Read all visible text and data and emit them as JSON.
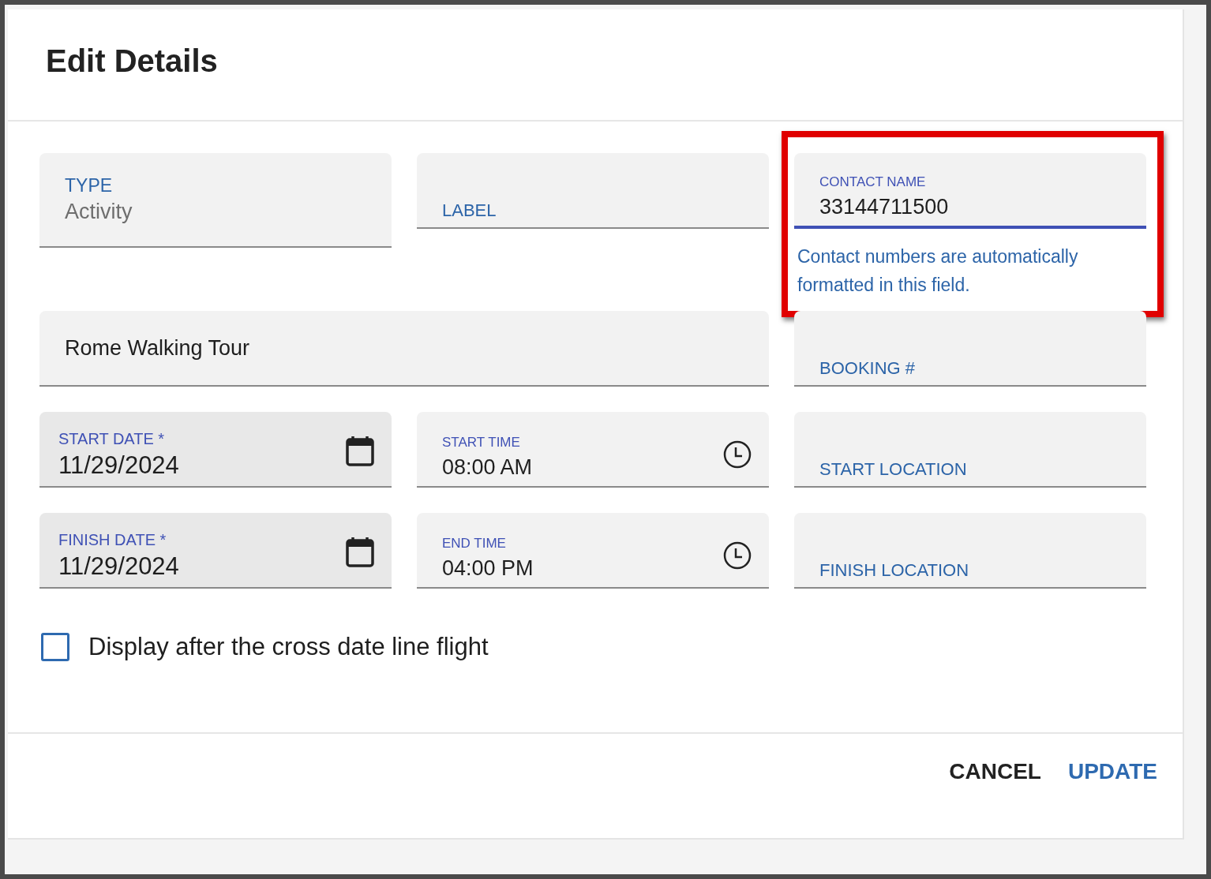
{
  "dialog": {
    "title": "Edit Details"
  },
  "fields": [
    {
      "kind": "select",
      "label": "TYPE",
      "value": "Activity"
    },
    {
      "kind": "text",
      "label": "LABEL"
    },
    {
      "kind": "text",
      "label": "CONTACT NAME",
      "value": "33144711500",
      "focused": true,
      "highlighted": true,
      "helper": "Contact numbers are automatically formatted in this field."
    },
    {
      "kind": "text",
      "wide": true,
      "value": "Rome Walking Tour"
    },
    {
      "kind": "text",
      "label": "BOOKING #"
    },
    {
      "kind": "date",
      "label": "START DATE *",
      "value": "11/29/2024"
    },
    {
      "kind": "time",
      "label": "START TIME",
      "value": "08:00 AM"
    },
    {
      "kind": "text",
      "label": "START LOCATION"
    },
    {
      "kind": "date",
      "label": "FINISH DATE *",
      "value": "11/29/2024"
    },
    {
      "kind": "time",
      "label": "END TIME",
      "value": "04:00 PM"
    },
    {
      "kind": "text",
      "label": "FINISH LOCATION"
    }
  ],
  "checkbox": {
    "label": "Display after the cross date line flight",
    "checked": false
  },
  "buttons": [
    {
      "label": "CANCEL",
      "kind": "secondary"
    },
    {
      "label": "UPDATE",
      "kind": "primary"
    }
  ]
}
